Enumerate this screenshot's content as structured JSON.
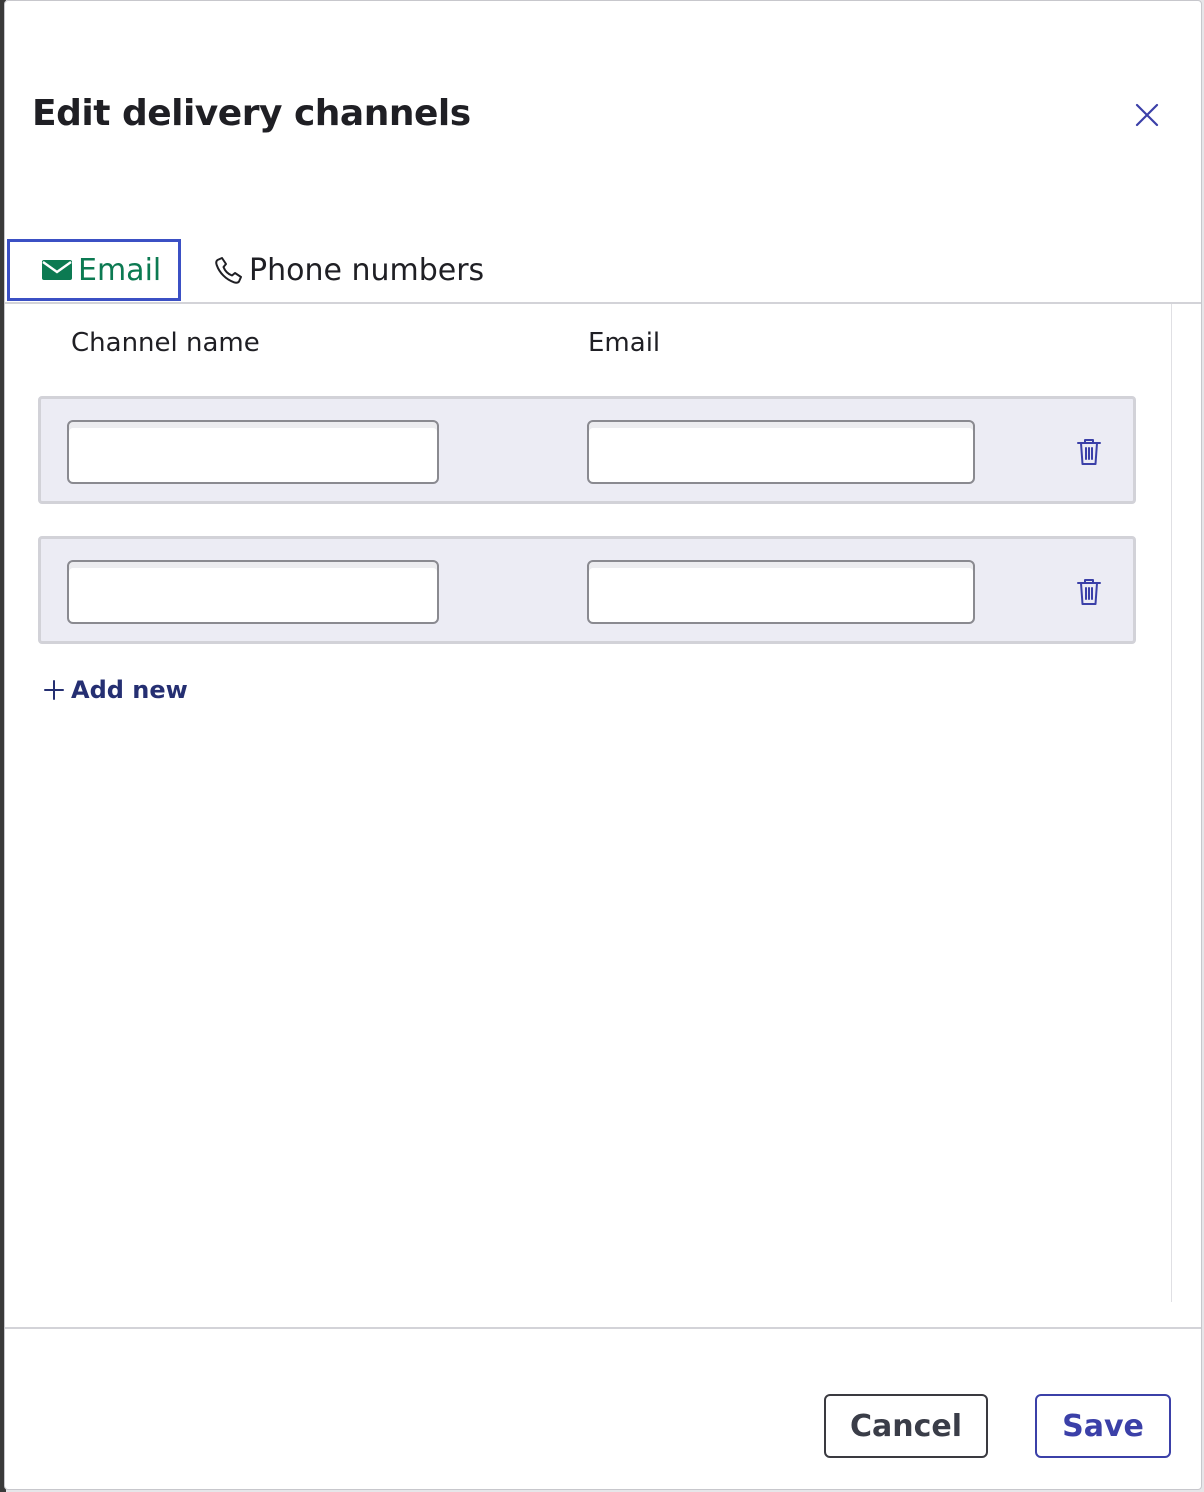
{
  "dialog": {
    "title": "Edit delivery channels"
  },
  "tabs": [
    {
      "label": "Email",
      "icon": "envelope-icon",
      "active": true
    },
    {
      "label": "Phone numbers",
      "icon": "phone-icon",
      "active": false
    }
  ],
  "table": {
    "headers": [
      "Channel name",
      "Email"
    ],
    "rows": [
      {
        "channel_name": "",
        "email": ""
      },
      {
        "channel_name": "",
        "email": ""
      }
    ]
  },
  "add_new_label": "Add new",
  "footer": {
    "cancel_label": "Cancel",
    "save_label": "Save"
  },
  "colors": {
    "active_tab_text": "#0c7a52",
    "focus_ring": "#3b50c4",
    "row_background": "#ececf4",
    "link": "#252f72",
    "primary_outline": "#3b40a8"
  }
}
